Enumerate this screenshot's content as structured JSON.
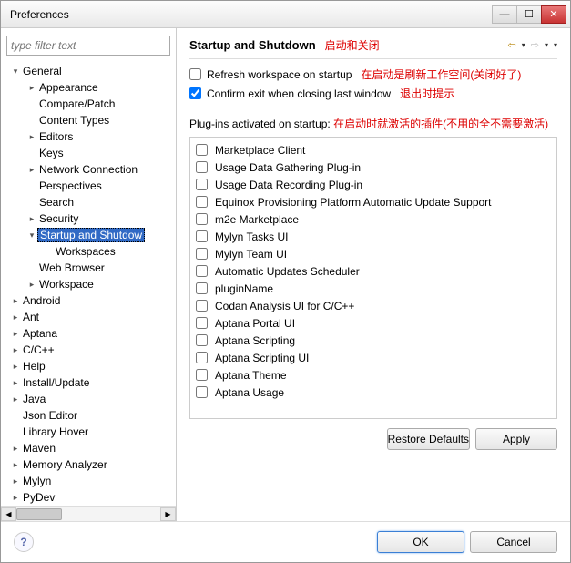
{
  "window": {
    "title": "Preferences"
  },
  "filter": {
    "placeholder": "type filter text"
  },
  "tree": [
    {
      "label": "General",
      "depth": 0,
      "expanded": true,
      "hasChildren": true
    },
    {
      "label": "Appearance",
      "depth": 1,
      "expanded": false,
      "hasChildren": true
    },
    {
      "label": "Compare/Patch",
      "depth": 1,
      "hasChildren": false
    },
    {
      "label": "Content Types",
      "depth": 1,
      "hasChildren": false
    },
    {
      "label": "Editors",
      "depth": 1,
      "expanded": false,
      "hasChildren": true
    },
    {
      "label": "Keys",
      "depth": 1,
      "hasChildren": false
    },
    {
      "label": "Network Connection",
      "depth": 1,
      "expanded": false,
      "hasChildren": true
    },
    {
      "label": "Perspectives",
      "depth": 1,
      "hasChildren": false
    },
    {
      "label": "Search",
      "depth": 1,
      "hasChildren": false
    },
    {
      "label": "Security",
      "depth": 1,
      "expanded": false,
      "hasChildren": true
    },
    {
      "label": "Startup and Shutdow",
      "depth": 1,
      "expanded": true,
      "hasChildren": true,
      "selected": true
    },
    {
      "label": "Workspaces",
      "depth": 2,
      "hasChildren": false
    },
    {
      "label": "Web Browser",
      "depth": 1,
      "hasChildren": false
    },
    {
      "label": "Workspace",
      "depth": 1,
      "expanded": false,
      "hasChildren": true
    },
    {
      "label": "Android",
      "depth": 0,
      "expanded": false,
      "hasChildren": true
    },
    {
      "label": "Ant",
      "depth": 0,
      "expanded": false,
      "hasChildren": true
    },
    {
      "label": "Aptana",
      "depth": 0,
      "expanded": false,
      "hasChildren": true
    },
    {
      "label": "C/C++",
      "depth": 0,
      "expanded": false,
      "hasChildren": true
    },
    {
      "label": "Help",
      "depth": 0,
      "expanded": false,
      "hasChildren": true
    },
    {
      "label": "Install/Update",
      "depth": 0,
      "expanded": false,
      "hasChildren": true
    },
    {
      "label": "Java",
      "depth": 0,
      "expanded": false,
      "hasChildren": true
    },
    {
      "label": "Json Editor",
      "depth": 0,
      "hasChildren": false
    },
    {
      "label": "Library Hover",
      "depth": 0,
      "hasChildren": false
    },
    {
      "label": "Maven",
      "depth": 0,
      "expanded": false,
      "hasChildren": true
    },
    {
      "label": "Memory Analyzer",
      "depth": 0,
      "expanded": false,
      "hasChildren": true
    },
    {
      "label": "Mylyn",
      "depth": 0,
      "expanded": false,
      "hasChildren": true
    },
    {
      "label": "PyDev",
      "depth": 0,
      "expanded": false,
      "hasChildren": true
    }
  ],
  "page": {
    "title": "Startup and Shutdown",
    "title_annotation": "启动和关闭",
    "opt_refresh": "Refresh workspace on startup",
    "opt_refresh_note": "在启动是刷新工作空间(关闭好了)",
    "opt_refresh_checked": false,
    "opt_confirm": "Confirm exit when closing last window",
    "opt_confirm_note": "退出时提示",
    "opt_confirm_checked": true,
    "plugins_label": "Plug-ins activated on startup:",
    "plugins_note": "在启动时就激活的插件(不用的全不需要激活)",
    "plugins": [
      "Marketplace Client",
      "Usage Data Gathering Plug-in",
      "Usage Data Recording Plug-in",
      "Equinox Provisioning Platform Automatic Update Support",
      "m2e Marketplace",
      "Mylyn Tasks UI",
      "Mylyn Team UI",
      "Automatic Updates Scheduler",
      "pluginName",
      "Codan Analysis UI for C/C++",
      "Aptana Portal UI",
      "Aptana Scripting",
      "Aptana Scripting UI",
      "Aptana Theme",
      "Aptana Usage"
    ]
  },
  "buttons": {
    "restore": "Restore Defaults",
    "apply": "Apply",
    "ok": "OK",
    "cancel": "Cancel"
  }
}
